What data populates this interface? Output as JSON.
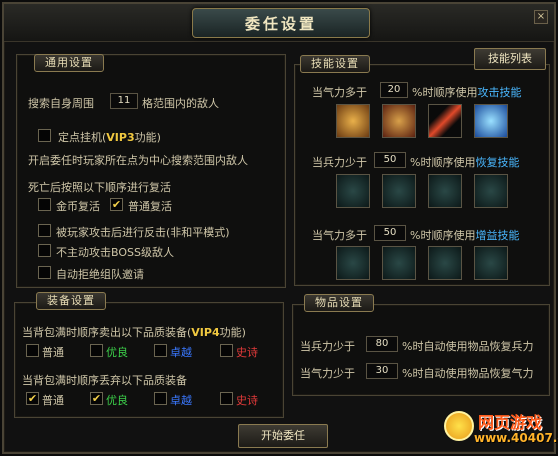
{
  "window": {
    "title": "委任设置",
    "close_label": "×"
  },
  "general": {
    "tab": "通用设置",
    "search_prefix": "搜索自身周围",
    "search_value": "11",
    "search_suffix": "格范围内的敌人",
    "fixed_point_label": "定点挂机(",
    "fixed_point_vip": "VIP3",
    "fixed_point_suffix": "功能)",
    "fixed_point_desc": "开启委任时玩家所在点为中心搜索范围内敌人",
    "revive_title": "死亡后按照以下顺序进行复活",
    "revive_gold": "金币复活",
    "revive_normal": "普通复活",
    "counter_attack": "被玩家攻击后进行反击(非和平模式)",
    "no_boss": "不主动攻击BOSS级敌人",
    "reject_team": "自动拒绝组队邀请"
  },
  "skills": {
    "tab": "技能设置",
    "list_button": "技能列表",
    "attack_prefix": "当气力多于",
    "attack_value": "20",
    "attack_mid": "%时顺序使用",
    "attack_type": "攻击技能",
    "heal_prefix": "当兵力少于",
    "heal_value": "50",
    "heal_mid": "%时顺序使用",
    "heal_type": "恢复技能",
    "buff_prefix": "当气力多于",
    "buff_value": "50",
    "buff_mid": "%时顺序使用",
    "buff_type": "增益技能"
  },
  "equipment": {
    "tab": "装备设置",
    "sell_title_prefix": "当背包满时顺序卖出以下品质装备(",
    "sell_vip": "VIP4",
    "sell_title_suffix": "功能)",
    "discard_title": "当背包满时顺序丢弃以下品质装备",
    "qualities": [
      "普通",
      "优良",
      "卓越",
      "史诗"
    ]
  },
  "items": {
    "tab": "物品设置",
    "troop_prefix": "当兵力少于",
    "troop_value": "80",
    "troop_suffix": "%时自动使用物品恢复兵力",
    "qi_prefix": "当气力少于",
    "qi_value": "30",
    "qi_suffix": "%时自动使用物品恢复气力"
  },
  "start_button": "开始委任",
  "watermark": {
    "title": "网页游戏",
    "url": "www.40407.com"
  },
  "checkmark": "✔",
  "colors": {
    "good": "#3cd04a",
    "excellent": "#3a78ff",
    "epic": "#e23a3a",
    "vip": "#f0c840"
  }
}
